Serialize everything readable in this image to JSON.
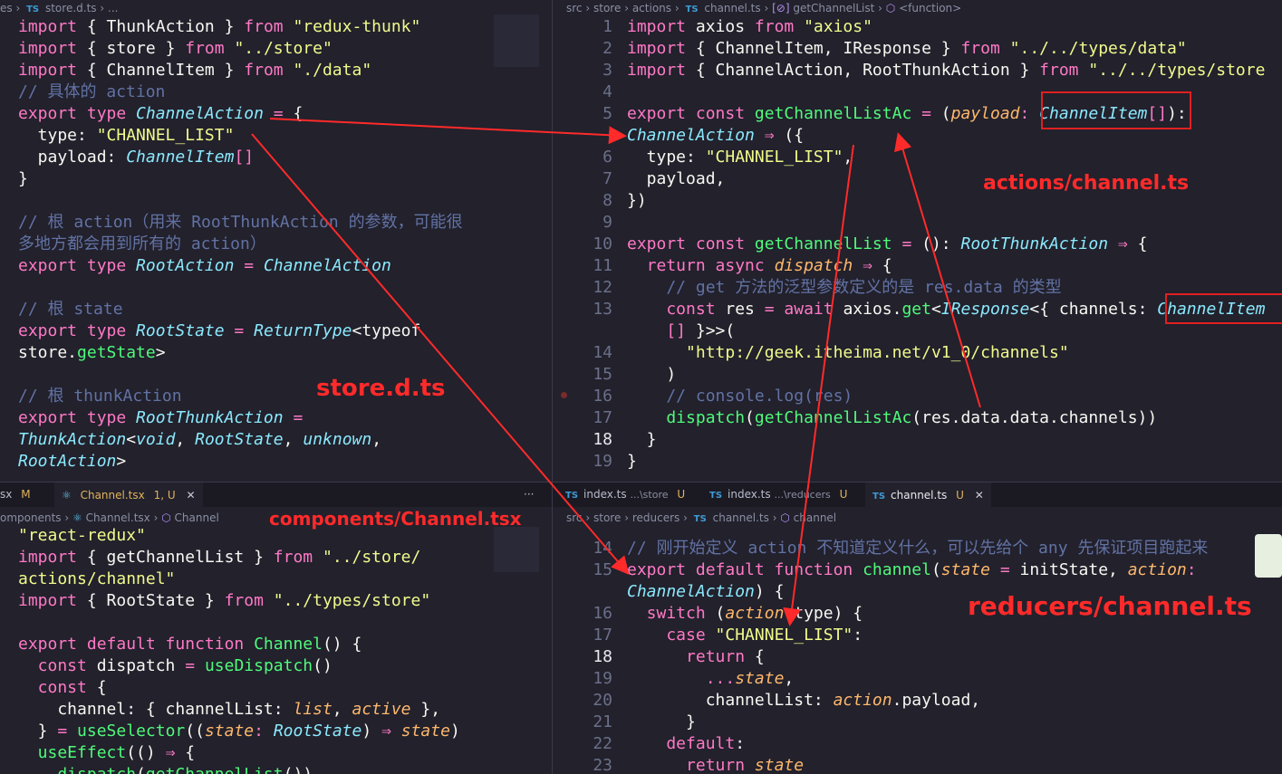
{
  "top_left": {
    "breadcrumb": [
      "es",
      "store.d.ts",
      "..."
    ],
    "lines": [
      [
        [
          "k",
          "import"
        ],
        [
          "n",
          " { ThunkAction } "
        ],
        [
          "k",
          "from"
        ],
        [
          "s",
          " \"redux-thunk\""
        ]
      ],
      [
        [
          "k",
          "import"
        ],
        [
          "n",
          " { store } "
        ],
        [
          "k",
          "from"
        ],
        [
          "s",
          " \"../store\""
        ]
      ],
      [
        [
          "k",
          "import"
        ],
        [
          "n",
          " { ChannelItem } "
        ],
        [
          "k",
          "from"
        ],
        [
          "s",
          " \"./data\""
        ]
      ],
      [
        [
          "c",
          "// 具体的 action"
        ]
      ],
      [
        [
          "k",
          "export type "
        ],
        [
          "t",
          "ChannelAction"
        ],
        [
          "k",
          " = "
        ],
        [
          "n",
          "{"
        ]
      ],
      [
        [
          "n",
          "  type: "
        ],
        [
          "s",
          "\"CHANNEL_LIST\""
        ]
      ],
      [
        [
          "n",
          "  payload: "
        ],
        [
          "t",
          "ChannelItem"
        ],
        [
          "k",
          "[]"
        ]
      ],
      [
        [
          "n",
          "}"
        ]
      ],
      [
        [
          "n",
          ""
        ]
      ],
      [
        [
          "c",
          "// 根 action（用来 RootThunkAction 的参数，可能很"
        ]
      ],
      [
        [
          "c",
          "多地方都会用到所有的 action）"
        ]
      ],
      [
        [
          "k",
          "export type "
        ],
        [
          "t",
          "RootAction"
        ],
        [
          "k",
          " = "
        ],
        [
          "t",
          "ChannelAction"
        ]
      ],
      [
        [
          "n",
          ""
        ]
      ],
      [
        [
          "c",
          "// 根 state"
        ]
      ],
      [
        [
          "k",
          "export type "
        ],
        [
          "t",
          "RootState"
        ],
        [
          "k",
          " = "
        ],
        [
          "t",
          "ReturnType"
        ],
        [
          "n",
          "<typeof"
        ]
      ],
      [
        [
          "n",
          "store."
        ],
        [
          "f",
          "getState"
        ],
        [
          "n",
          ">"
        ]
      ],
      [
        [
          "n",
          ""
        ]
      ],
      [
        [
          "c",
          "// 根 thunkAction"
        ]
      ],
      [
        [
          "k",
          "export type "
        ],
        [
          "t",
          "RootThunkAction"
        ],
        [
          "k",
          " ="
        ]
      ],
      [
        [
          "t",
          "ThunkAction"
        ],
        [
          "n",
          "<"
        ],
        [
          "t",
          "void"
        ],
        [
          "n",
          ", "
        ],
        [
          "t",
          "RootState"
        ],
        [
          "n",
          ", "
        ],
        [
          "t",
          "unknown"
        ],
        [
          "n",
          ","
        ]
      ],
      [
        [
          "t",
          "RootAction"
        ],
        [
          "n",
          ">"
        ]
      ]
    ]
  },
  "top_right": {
    "breadcrumb": [
      "src",
      "store",
      "actions",
      "channel.ts",
      "getChannelList",
      "<function>"
    ],
    "lines": [
      {
        "n": "1",
        "seg": [
          [
            "k",
            "import"
          ],
          [
            "n",
            " axios "
          ],
          [
            "k",
            "from"
          ],
          [
            "s",
            " \"axios\""
          ]
        ]
      },
      {
        "n": "2",
        "seg": [
          [
            "k",
            "import"
          ],
          [
            "n",
            " { ChannelItem, IResponse } "
          ],
          [
            "k",
            "from"
          ],
          [
            "s",
            " \"../../types/data\""
          ]
        ]
      },
      {
        "n": "3",
        "seg": [
          [
            "k",
            "import"
          ],
          [
            "n",
            " { ChannelAction, RootThunkAction } "
          ],
          [
            "k",
            "from"
          ],
          [
            "s",
            " \"../../types/store"
          ]
        ]
      },
      {
        "n": "4",
        "seg": [
          [
            "n",
            ""
          ]
        ]
      },
      {
        "n": "5",
        "seg": [
          [
            "k",
            "export const "
          ],
          [
            "f",
            "getChannelListAc"
          ],
          [
            "k",
            " = "
          ],
          [
            "n",
            "("
          ],
          [
            "p",
            "payload"
          ],
          [
            "k",
            ": "
          ],
          [
            "t",
            "ChannelItem"
          ],
          [
            "k",
            "[]"
          ],
          [
            "n",
            "):"
          ]
        ]
      },
      {
        "n": "",
        "seg": [
          [
            "t",
            "ChannelAction"
          ],
          [
            "k",
            " ⇒ "
          ],
          [
            "n",
            "({"
          ]
        ]
      },
      {
        "n": "6",
        "seg": [
          [
            "n",
            "  type: "
          ],
          [
            "s",
            "\"CHANNEL_LIST\""
          ],
          [
            "n",
            ","
          ]
        ]
      },
      {
        "n": "7",
        "seg": [
          [
            "n",
            "  payload,"
          ]
        ]
      },
      {
        "n": "8",
        "seg": [
          [
            "n",
            "})"
          ]
        ]
      },
      {
        "n": "9",
        "seg": [
          [
            "n",
            ""
          ]
        ]
      },
      {
        "n": "10",
        "seg": [
          [
            "k",
            "export const "
          ],
          [
            "f",
            "getChannelList"
          ],
          [
            "k",
            " = "
          ],
          [
            "n",
            "(): "
          ],
          [
            "t",
            "RootThunkAction"
          ],
          [
            "k",
            " ⇒ "
          ],
          [
            "n",
            "{"
          ]
        ]
      },
      {
        "n": "11",
        "seg": [
          [
            "k",
            "  return async "
          ],
          [
            "p",
            "dispatch"
          ],
          [
            "k",
            " ⇒ "
          ],
          [
            "n",
            "{"
          ]
        ]
      },
      {
        "n": "12",
        "seg": [
          [
            "c",
            "    // get 方法的泛型参数定义的是 res.data 的类型"
          ]
        ]
      },
      {
        "n": "13",
        "seg": [
          [
            "k",
            "    const "
          ],
          [
            "n",
            "res "
          ],
          [
            "k",
            "= await "
          ],
          [
            "n",
            "axios."
          ],
          [
            "f",
            "get"
          ],
          [
            "n",
            "<"
          ],
          [
            "t",
            "IResponse"
          ],
          [
            "n",
            "<{ channels: "
          ],
          [
            "t",
            "ChannelItem"
          ]
        ]
      },
      {
        "n": "",
        "seg": [
          [
            "k",
            "    [] "
          ],
          [
            "n",
            "}>>("
          ]
        ]
      },
      {
        "n": "14",
        "seg": [
          [
            "s",
            "      \"http://geek.itheima.net/v1_0/channels\""
          ]
        ]
      },
      {
        "n": "15",
        "seg": [
          [
            "n",
            "    )"
          ]
        ]
      },
      {
        "n": "16",
        "seg": [
          [
            "c",
            "    // console.log(res)"
          ]
        ]
      },
      {
        "n": "17",
        "seg": [
          [
            "f",
            "    dispatch"
          ],
          [
            "n",
            "("
          ],
          [
            "f",
            "getChannelListAc"
          ],
          [
            "n",
            "(res.data.data.channels))"
          ]
        ]
      },
      {
        "n": "18",
        "seg": [
          [
            "n",
            "  }"
          ]
        ]
      },
      {
        "n": "19",
        "seg": [
          [
            "n",
            "}"
          ]
        ]
      }
    ]
  },
  "bottom_left": {
    "tabs": [
      {
        "label": "sx",
        "badge": "M"
      },
      {
        "label": "Channel.tsx",
        "badge": "1, U"
      }
    ],
    "more": "···",
    "breadcrumb": [
      "omponents",
      "Channel.tsx",
      "Channel"
    ],
    "lines": [
      [
        [
          "s",
          "\"react-redux\""
        ]
      ],
      [
        [
          "k",
          "import"
        ],
        [
          "n",
          " { getChannelList } "
        ],
        [
          "k",
          "from"
        ],
        [
          "s",
          " \"../store/"
        ]
      ],
      [
        [
          "s",
          "actions/channel\""
        ]
      ],
      [
        [
          "k",
          "import"
        ],
        [
          "n",
          " { RootState } "
        ],
        [
          "k",
          "from"
        ],
        [
          "s",
          " \"../types/store\""
        ]
      ],
      [
        [
          "n",
          ""
        ]
      ],
      [
        [
          "k",
          "export default function "
        ],
        [
          "f",
          "Channel"
        ],
        [
          "n",
          "() {"
        ]
      ],
      [
        [
          "k",
          "  const "
        ],
        [
          "n",
          "dispatch "
        ],
        [
          "k",
          "= "
        ],
        [
          "f",
          "useDispatch"
        ],
        [
          "n",
          "()"
        ]
      ],
      [
        [
          "k",
          "  const "
        ],
        [
          "n",
          "{"
        ]
      ],
      [
        [
          "n",
          "    channel: { channelList: "
        ],
        [
          "p",
          "list"
        ],
        [
          "n",
          ", "
        ],
        [
          "p",
          "active"
        ],
        [
          "n",
          " },"
        ]
      ],
      [
        [
          "n",
          "  } "
        ],
        [
          "k",
          "= "
        ],
        [
          "f",
          "useSelector"
        ],
        [
          "n",
          "(("
        ],
        [
          "p",
          "state"
        ],
        [
          "k",
          ": "
        ],
        [
          "t",
          "RootState"
        ],
        [
          "n",
          ") "
        ],
        [
          "k",
          "⇒ "
        ],
        [
          "p",
          "state"
        ],
        [
          "n",
          ")"
        ]
      ],
      [
        [
          "f",
          "  useEffect"
        ],
        [
          "n",
          "(() "
        ],
        [
          "k",
          "⇒ "
        ],
        [
          "n",
          "{"
        ]
      ],
      [
        [
          "f",
          "    dispatch"
        ],
        [
          "n",
          "("
        ],
        [
          "f",
          "getChannelList"
        ],
        [
          "n",
          "())"
        ]
      ]
    ]
  },
  "bottom_right": {
    "tabs": [
      {
        "label": "index.ts",
        "path": "...\\store",
        "badge": "U"
      },
      {
        "label": "index.ts",
        "path": "...\\reducers",
        "badge": "U"
      },
      {
        "label": "channel.ts",
        "path": "",
        "badge": "U"
      }
    ],
    "breadcrumb": [
      "src",
      "store",
      "reducers",
      "channel.ts",
      "channel"
    ],
    "lines": [
      {
        "n": "14",
        "seg": [
          [
            "c",
            "// 刚开始定义 action 不知道定义什么，可以先给个 any 先保证项目跑起来"
          ]
        ]
      },
      {
        "n": "15",
        "seg": [
          [
            "k",
            "export default function "
          ],
          [
            "f",
            "channel"
          ],
          [
            "n",
            "("
          ],
          [
            "p",
            "state"
          ],
          [
            "k",
            " = "
          ],
          [
            "n",
            "initState, "
          ],
          [
            "p",
            "action"
          ],
          [
            "k",
            ":"
          ]
        ]
      },
      {
        "n": "",
        "seg": [
          [
            "t",
            "ChannelAction"
          ],
          [
            "n",
            ") {"
          ]
        ]
      },
      {
        "n": "16",
        "seg": [
          [
            "k",
            "  switch "
          ],
          [
            "n",
            "("
          ],
          [
            "p",
            "action"
          ],
          [
            "n",
            ".type) {"
          ]
        ]
      },
      {
        "n": "17",
        "seg": [
          [
            "k",
            "    case "
          ],
          [
            "s",
            "\"CHANNEL_LIST\""
          ],
          [
            "n",
            ":"
          ]
        ]
      },
      {
        "n": "18",
        "seg": [
          [
            "k",
            "      return "
          ],
          [
            "n",
            "{"
          ]
        ]
      },
      {
        "n": "19",
        "seg": [
          [
            "k",
            "        ..."
          ],
          [
            "p",
            "state"
          ],
          [
            "n",
            ","
          ]
        ]
      },
      {
        "n": "20",
        "seg": [
          [
            "n",
            "        channelList: "
          ],
          [
            "p",
            "action"
          ],
          [
            "n",
            ".payload,"
          ]
        ]
      },
      {
        "n": "21",
        "seg": [
          [
            "n",
            "      }"
          ]
        ]
      },
      {
        "n": "22",
        "seg": [
          [
            "k",
            "    default"
          ],
          [
            "n",
            ":"
          ]
        ]
      },
      {
        "n": "23",
        "seg": [
          [
            "k",
            "      return "
          ],
          [
            "p",
            "state"
          ]
        ]
      }
    ]
  },
  "labels": {
    "store": "store.d.ts",
    "actions": "actions/channel.ts",
    "components": "components/Channel.tsx",
    "reducers": "reducers/channel.ts"
  },
  "colors": {
    "annotation": "#ff2a2a",
    "keyword": "#ff79c6",
    "string": "#f1fa8c",
    "type": "#8be9fd",
    "comment": "#6272a4"
  }
}
